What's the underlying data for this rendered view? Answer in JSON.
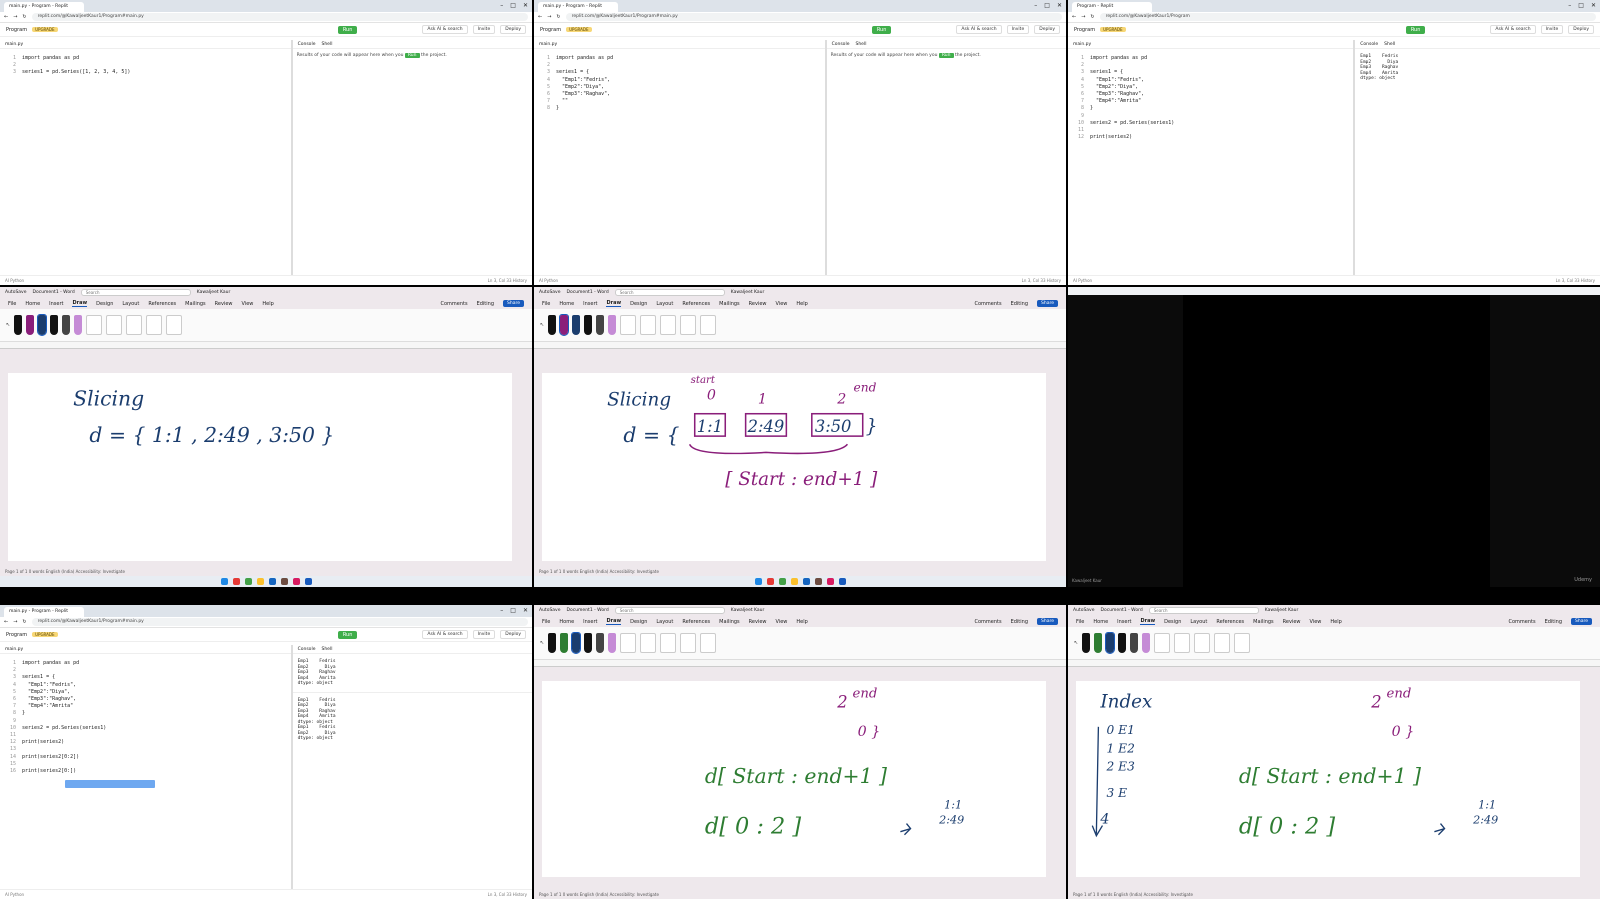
{
  "browser": {
    "tab_main": "main.py - Program - Replit",
    "tab_program": "Program - Replit",
    "url": "replit.com/@KawaljeetKaur1/Program#main.py",
    "url_short": "replit.com/@KawaljeetKaur1/Program",
    "app_name": "Program",
    "badge": "UPGRADE",
    "run": "Run",
    "ask_ai": "Ask AI & search",
    "invite": "Invite",
    "deploy": "Deploy",
    "file": "main.py",
    "console_tab": "Console",
    "shell_tab": "Shell",
    "placeholder_pre": "Results of your code will appear here when you",
    "placeholder_run": "Run",
    "placeholder_post": "the project.",
    "status_left": "AI  Python",
    "status_right": "Ln 3, Col 33  History"
  },
  "code1": [
    {
      "n": "1",
      "t": "import pandas as pd"
    },
    {
      "n": "2",
      "t": ""
    },
    {
      "n": "3",
      "t": "series1 = pd.Series([1, 2, 3, 4, 5])"
    }
  ],
  "code2": [
    {
      "n": "1",
      "t": "import pandas as pd"
    },
    {
      "n": "2",
      "t": ""
    },
    {
      "n": "3",
      "t": "series1 = {"
    },
    {
      "n": "4",
      "t": "  \"Emp1\":\"Fedris\","
    },
    {
      "n": "5",
      "t": "  \"Emp2\":\"Diya\","
    },
    {
      "n": "6",
      "t": "  \"Emp3\":\"Raghav\","
    },
    {
      "n": "7",
      "t": "  \"\""
    },
    {
      "n": "8",
      "t": "}"
    }
  ],
  "code3": [
    {
      "n": "1",
      "t": "import pandas as pd"
    },
    {
      "n": "2",
      "t": ""
    },
    {
      "n": "3",
      "t": "series1 = {"
    },
    {
      "n": "4",
      "t": "  \"Emp1\":\"Fedris\","
    },
    {
      "n": "5",
      "t": "  \"Emp2\":\"Diya\","
    },
    {
      "n": "6",
      "t": "  \"Emp3\":\"Raghav\","
    },
    {
      "n": "7",
      "t": "  \"Emp4\":\"Amrita\""
    },
    {
      "n": "8",
      "t": "}"
    },
    {
      "n": "9",
      "t": ""
    },
    {
      "n": "10",
      "t": "series2 = pd.Series(series1)"
    },
    {
      "n": "11",
      "t": ""
    },
    {
      "n": "12",
      "t": "print(series2)"
    }
  ],
  "out3": "Emp1    Fedris\nEmp2      Diya\nEmp3    Raghav\nEmp4    Amrita\ndtype: object",
  "code4": [
    {
      "n": "1",
      "t": "import pandas as pd"
    },
    {
      "n": "2",
      "t": ""
    },
    {
      "n": "3",
      "t": "series1 = {"
    },
    {
      "n": "4",
      "t": "  \"Emp1\":\"Fedris\","
    },
    {
      "n": "5",
      "t": "  \"Emp2\":\"Diya\","
    },
    {
      "n": "6",
      "t": "  \"Emp3\":\"Raghav\","
    },
    {
      "n": "7",
      "t": "  \"Emp4\":\"Amrita\""
    },
    {
      "n": "8",
      "t": "}"
    },
    {
      "n": "9",
      "t": ""
    },
    {
      "n": "10",
      "t": "series2 = pd.Series(series1)"
    },
    {
      "n": "11",
      "t": ""
    },
    {
      "n": "12",
      "t": "print(series2)"
    },
    {
      "n": "13",
      "t": ""
    },
    {
      "n": "14",
      "t": "print(series2[0:2])"
    },
    {
      "n": "15",
      "t": ""
    },
    {
      "n": "16",
      "t": "print(series2[0:])"
    }
  ],
  "out4a": "Emp1    Fedris\nEmp2      Diya\nEmp3    Raghav\nEmp4    Amrita\ndtype: object",
  "out4b": "Emp1    Fedris\nEmp2      Diya\nEmp3    Raghav\nEmp4    Amrita\ndtype: object\nEmp1    Fedris\nEmp2      Diya\ndtype: object",
  "word": {
    "autosave": "AutoSave",
    "doc": "Document1 - Word",
    "search": "Search",
    "user": "Kawaljeet Kaur",
    "menu": [
      "File",
      "Home",
      "Insert",
      "Draw",
      "Design",
      "Layout",
      "References",
      "Mailings",
      "Review",
      "View",
      "Help"
    ],
    "comments": "Comments",
    "editing": "Editing",
    "share": "Share",
    "status": "Page 1 of 1   0 words   English (India)   Accessibility: Investigate",
    "focus": "Focus"
  },
  "ink1": {
    "title": "Slicing",
    "eq": "d = { 1:1 , 2:49 , 3:50 }"
  },
  "ink2": {
    "title": "Slicing",
    "start": "start",
    "i0": "0",
    "i1": "1",
    "i2": "2",
    "end": "end",
    "a": "1:1",
    "b": "2:49",
    "c": "3:50",
    "d": "d = {",
    "close": "}",
    "range": "[ Start : end+1 ]"
  },
  "ink3": {
    "i2": "2",
    "end": "end",
    "z": "0 }",
    "range": "d[ Start : end+1 ]",
    "ex": "d[ 0 : 2 ]",
    "r1": "1:1",
    "r2": "2:49"
  },
  "ink4": {
    "title": "Index",
    "rows": [
      "0  E1",
      "1  E2",
      "2  E3",
      "3  E"
    ],
    "i4": "4",
    "i2": "2",
    "end": "end",
    "z": "0 }",
    "range": "d[ Start : end+1 ]",
    "ex": "d[ 0 : 2 ]",
    "r1": "1:1",
    "r2": "2:49"
  },
  "udemy": "Udemy",
  "speaker": "Kawaljeet Kaur",
  "clock": "15:10\n23-08-2024",
  "colors": {
    "green": "#3fae4a",
    "ink_blue": "#1b3d6e",
    "ink_purple": "#8a1e7a",
    "ink_green": "#2e7d32",
    "word_blue": "#185abd"
  }
}
